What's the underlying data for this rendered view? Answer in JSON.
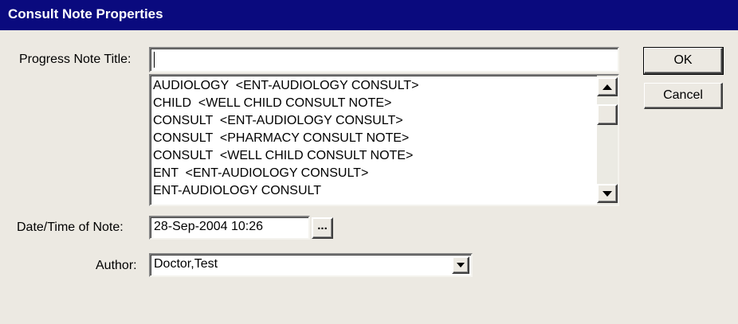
{
  "window": {
    "title": "Consult Note Properties"
  },
  "form": {
    "progress_note_title_label": "Progress Note Title:",
    "progress_note_title_value": "",
    "title_options": [
      "AUDIOLOGY  <ENT-AUDIOLOGY CONSULT>",
      "CHILD  <WELL CHILD CONSULT NOTE>",
      "CONSULT  <ENT-AUDIOLOGY CONSULT>",
      "CONSULT  <PHARMACY CONSULT NOTE>",
      "CONSULT  <WELL CHILD CONSULT NOTE>",
      "ENT  <ENT-AUDIOLOGY CONSULT>",
      "ENT-AUDIOLOGY CONSULT"
    ],
    "datetime_label": "Date/Time of Note:",
    "datetime_value": "28-Sep-2004 10:26",
    "datetime_button_label": "...",
    "author_label": "Author:",
    "author_value": "Doctor,Test"
  },
  "buttons": {
    "ok_label": "OK",
    "cancel_label": "Cancel"
  },
  "icons": {
    "scroll_up": "scroll-up-arrow-icon",
    "scroll_down": "scroll-down-arrow-icon",
    "dropdown": "chevron-down-icon"
  },
  "colors": {
    "titlebar": "#0a0a7e",
    "dialog_bg": "#ece9e2"
  }
}
